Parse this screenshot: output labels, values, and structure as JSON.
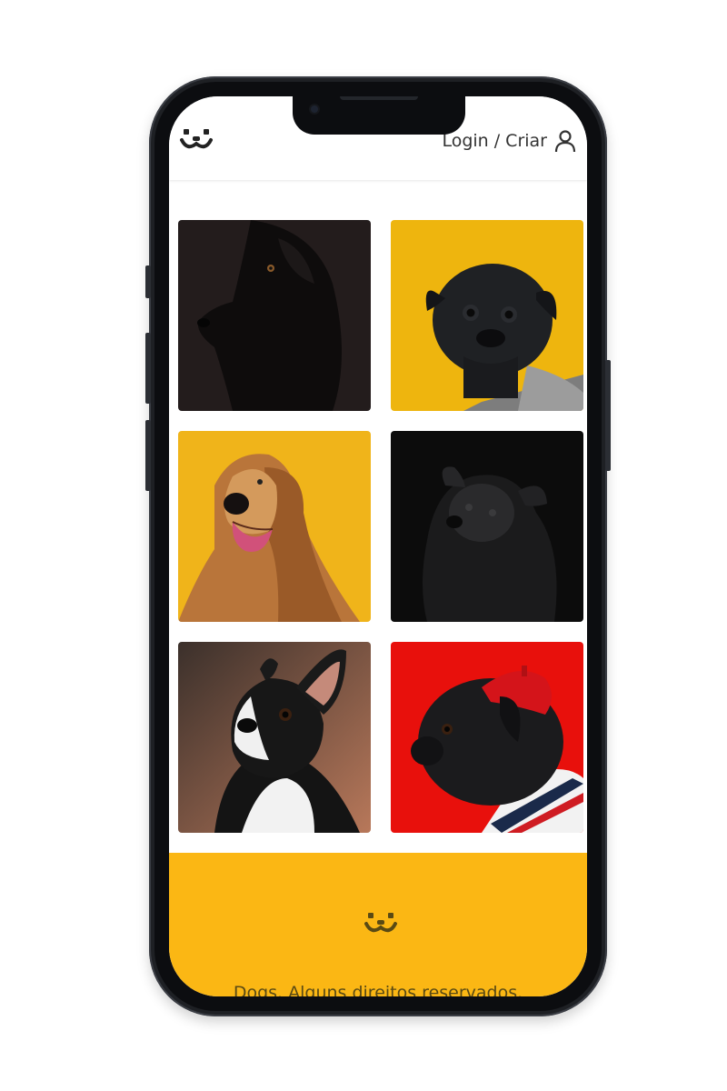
{
  "brand": {
    "logo_icon": "dog-face-icon",
    "accent_color": "#fbb714"
  },
  "header": {
    "login_label": "Login / Criar",
    "user_icon": "user-icon"
  },
  "feed": {
    "photos": [
      {
        "subject": "black dog",
        "background": "#231c1c"
      },
      {
        "subject": "black pug",
        "background": "#eeb50e"
      },
      {
        "subject": "afghan hound",
        "background": "#f0b41a"
      },
      {
        "subject": "black puppy",
        "background": "#0c0c0c"
      },
      {
        "subject": "boston terrier",
        "background": "#4a3a30"
      },
      {
        "subject": "pug with beret",
        "background": "#e8100c"
      }
    ]
  },
  "footer": {
    "text": "Dogs. Alguns direitos reservados.",
    "logo_icon": "dog-face-icon"
  }
}
